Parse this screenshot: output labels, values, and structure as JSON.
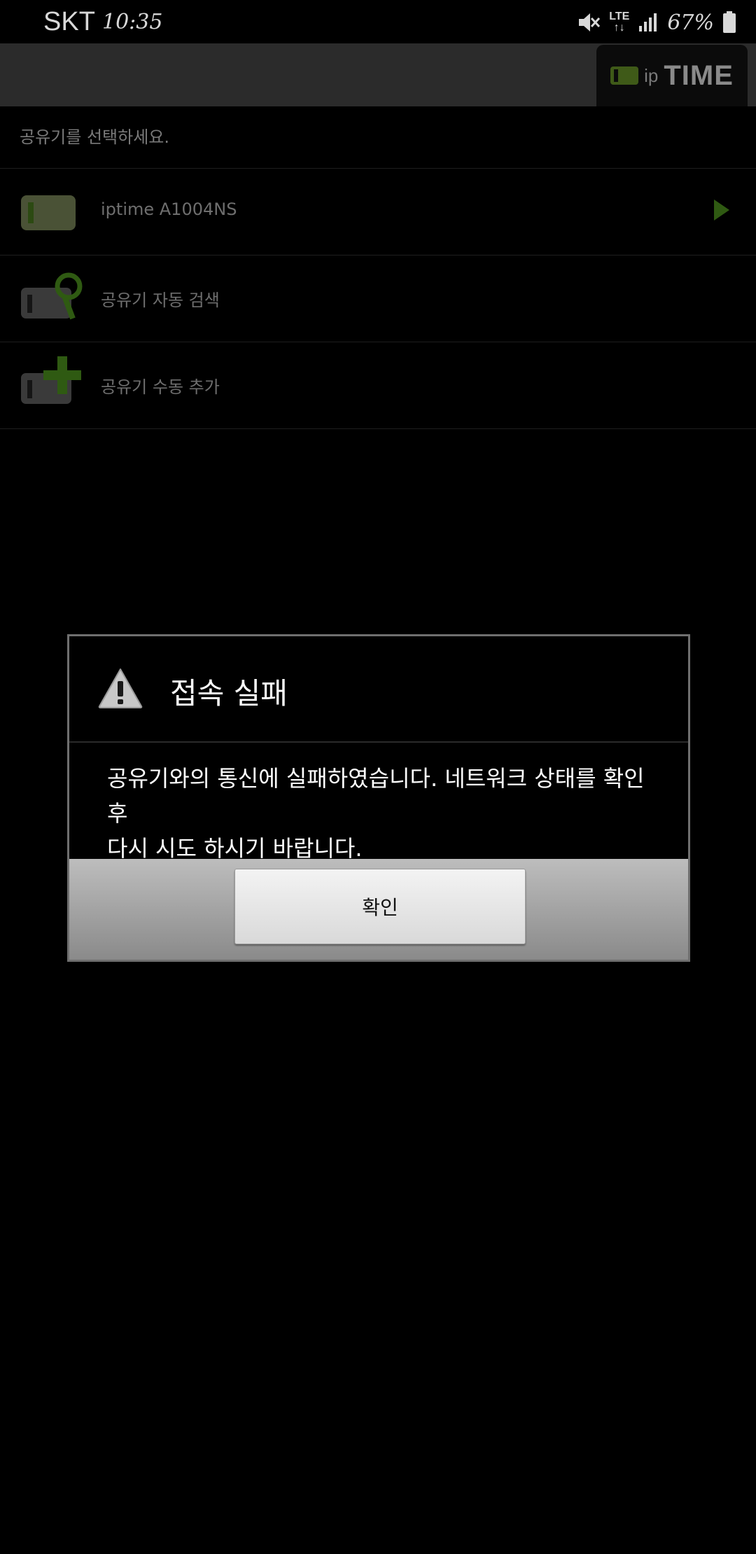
{
  "status_bar": {
    "carrier": "SKT",
    "time": "10:35",
    "network": "LTE",
    "battery": "67%",
    "icons": [
      "mute-icon",
      "lte-icon",
      "signal-icon",
      "battery-icon"
    ]
  },
  "header": {
    "logo_ip": "ip",
    "logo_time": "TIME"
  },
  "list": {
    "section_label": "공유기를 선택하세요.",
    "items": [
      {
        "label": "iptime A1004NS",
        "icon": "router-icon",
        "has_arrow": true
      },
      {
        "label": "공유기 자동 검색",
        "icon": "router-search-icon"
      },
      {
        "label": "공유기 수동 추가",
        "icon": "router-add-icon"
      }
    ]
  },
  "dialog": {
    "icon": "warning-icon",
    "title": "접속 실패",
    "message_line1": "공유기와의 통신에 실패하였습니다. 네트워크 상태를 확인 후",
    "message_line2": "다시 시도 하시기 바랍니다.",
    "ok_label": "확인"
  },
  "colors": {
    "accent_green": "#2f5a12",
    "header_bg": "#2b2b2b",
    "background": "#000000"
  }
}
